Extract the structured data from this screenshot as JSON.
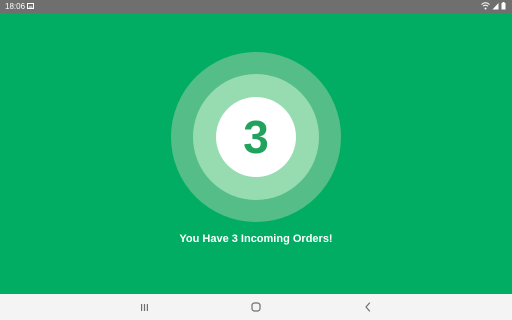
{
  "status_bar": {
    "time": "18:06",
    "icons": [
      "gallery-icon",
      "wifi-icon",
      "signal-icon",
      "battery-icon"
    ]
  },
  "main": {
    "order_count": "3",
    "message": "You Have 3 Incoming Orders!"
  },
  "nav_bar": {
    "buttons": [
      "recents-icon",
      "home-icon",
      "back-icon"
    ]
  },
  "colors": {
    "background": "#00ad63",
    "ring_outer": "#55be88",
    "ring_middle": "#97dcb0",
    "ring_inner": "#ffffff",
    "count_text": "#22a35d",
    "status_bar": "#6f6f6f",
    "nav_bar": "#f4f4f4"
  }
}
